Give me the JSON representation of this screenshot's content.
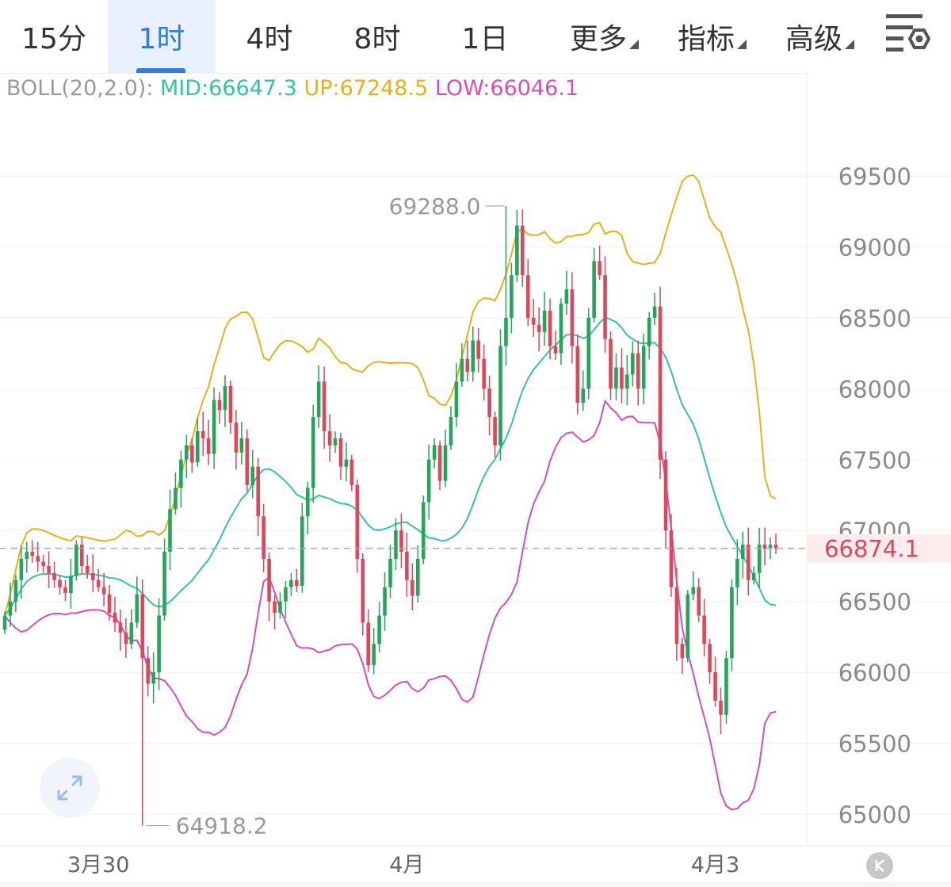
{
  "tabs": [
    {
      "label": "15分",
      "active": false
    },
    {
      "label": "1时",
      "active": true
    },
    {
      "label": "4时",
      "active": false
    },
    {
      "label": "8时",
      "active": false
    },
    {
      "label": "1日",
      "active": false
    },
    {
      "label": "更多",
      "active": false,
      "dropdown": true
    },
    {
      "label": "指标",
      "active": false,
      "dropdown": true
    },
    {
      "label": "高级",
      "active": false,
      "dropdown": true
    }
  ],
  "settings_icon": "chart-settings-icon",
  "indicator": {
    "name": "BOLL(20,2.0):",
    "mid": "MID:66647.3",
    "up": "UP:67248.5",
    "low": "LOW:66046.1"
  },
  "colors": {
    "up_candle": "#22a65a",
    "down_candle": "#e0455a",
    "mid": "#33c3a6",
    "upper": "#e6b219",
    "lower": "#d64dbb",
    "label_grey": "#999999",
    "current_price_red": "#e0455a",
    "active_tab": "#2f7de1"
  },
  "chart_data": {
    "type": "candlestick",
    "y_ticks": [
      65000,
      65500,
      66000,
      66500,
      67000,
      67500,
      68000,
      68500,
      69000,
      69500
    ],
    "y_tick_labels": [
      "65000",
      "65500",
      "66000",
      "66500",
      "67000",
      "67500",
      "68000",
      "68500",
      "69000",
      "69500"
    ],
    "ylim": [
      64780,
      70260
    ],
    "x_labels": [
      "3月30",
      "4月",
      "4月3"
    ],
    "x_label_candle_index": [
      17,
      73,
      129
    ],
    "high_marker": {
      "label": "69288.0",
      "value": 69288.0,
      "candle_index": 91
    },
    "low_marker": {
      "label": "64918.2",
      "value": 64918.2,
      "candle_index": 25
    },
    "current_price": {
      "label": "66874.1",
      "value": 66874.1
    },
    "closes": [
      66400,
      66500,
      66650,
      66800,
      66850,
      66820,
      66780,
      66750,
      66700,
      66650,
      66600,
      66560,
      66680,
      66900,
      66750,
      66700,
      66650,
      66600,
      66550,
      66420,
      66350,
      66280,
      66200,
      66350,
      66550,
      66100,
      65920,
      66000,
      66400,
      66850,
      67150,
      67300,
      67500,
      67600,
      67480,
      67700,
      67650,
      67540,
      67920,
      67850,
      68020,
      67760,
      67550,
      67650,
      67320,
      67450,
      67100,
      66800,
      66500,
      66420,
      66500,
      66600,
      66650,
      66610,
      67100,
      67300,
      67800,
      68050,
      67700,
      67600,
      67650,
      67450,
      67500,
      67320,
      66800,
      66350,
      66050,
      66200,
      66400,
      66600,
      66800,
      67000,
      66850,
      66650,
      66540,
      66800,
      67200,
      67500,
      67600,
      67350,
      67600,
      67800,
      68050,
      68210,
      68120,
      68340,
      68210,
      68000,
      67800,
      67600,
      68300,
      68500,
      68800,
      69150,
      68800,
      68500,
      68450,
      68400,
      68550,
      68300,
      68250,
      68600,
      68700,
      68300,
      67900,
      68000,
      68500,
      68900,
      68800,
      68350,
      68000,
      68150,
      68000,
      68100,
      68250,
      68000,
      68300,
      68500,
      68580,
      67500,
      67000,
      66600,
      66200,
      66100,
      66550,
      66600,
      66400,
      66200,
      66000,
      65800,
      65700,
      66100,
      66600,
      66800,
      66900,
      66650,
      66700,
      66900,
      66870,
      66900,
      66874
    ]
  }
}
